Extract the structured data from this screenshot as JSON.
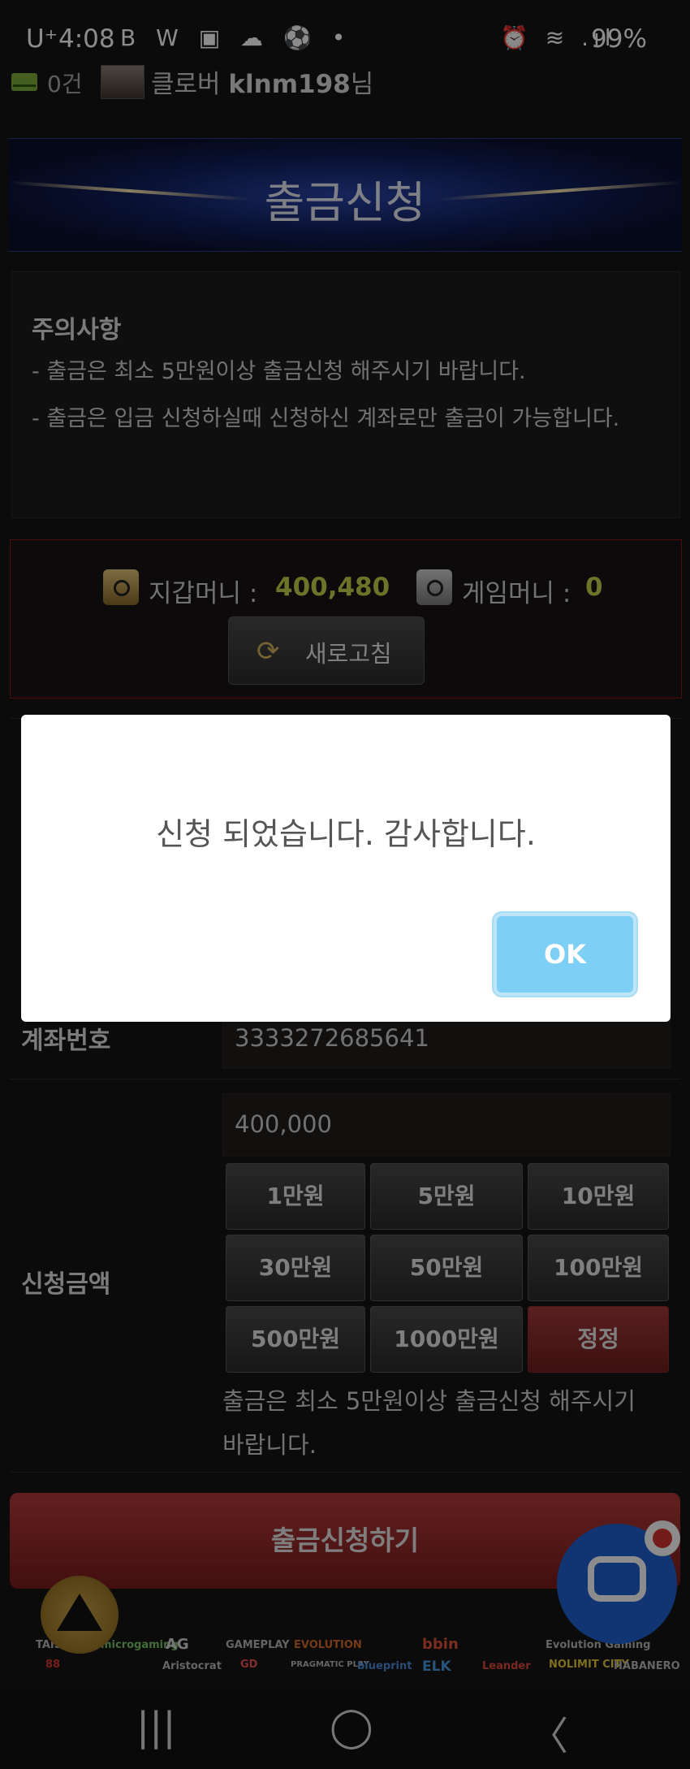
{
  "status_bar": {
    "time": "4:08",
    "carrier": "U⁺",
    "left_icons": "B W ▣ ☁ ⚽ •",
    "right_icons": "⏰ ≋ .ıl",
    "battery": "99%"
  },
  "user": {
    "mail_count": "0건",
    "prefix": "클로버",
    "name": "klnm198",
    "suffix": "님"
  },
  "page": {
    "title": "출금신청"
  },
  "notice": {
    "heading": "주의사항",
    "line1": "- 출금은 최소 5만원이상 출금신청 해주시기 바랍니다.",
    "line2": "- 출금은 입금 신청하실때 신청하신 계좌로만 출금이 가능합니다."
  },
  "wallet": {
    "wallet_label": "지갑머니 : ",
    "wallet_value": "400,480",
    "game_label": "게임머니 : ",
    "game_value": "0",
    "refresh_label": "새로고침"
  },
  "form": {
    "account_label": "계좌번호",
    "account_value": "3333272685641",
    "amount_label": "신청금액",
    "amount_value": "400,000",
    "amount_buttons": [
      "1만원",
      "5만원",
      "10만원",
      "30만원",
      "50만원",
      "100만원",
      "500만원",
      "1000만원",
      "정정"
    ],
    "note": "출금은 최소 5만원이상 출금신청 해주시기 바랍니다.",
    "submit_label": "출금신청하기"
  },
  "dialog": {
    "message": "신청 되었습니다. 감사합니다.",
    "ok_label": "OK"
  },
  "providers": [
    "TAISHAN",
    "microgaming",
    "AG",
    "GAMEPLAY",
    "EVOLUTION",
    "bbin",
    "Evolution Gaming",
    "88",
    "Aristocrat",
    "GD",
    "PRAGMATIC PLAY",
    "blueprint",
    "ELK",
    "Leander",
    "NOLIMIT CITY",
    "HABANERO"
  ],
  "colors": {
    "accent_red": "#8e1b1b",
    "money_green": "#c6d24a",
    "ok_blue": "#7ecff5"
  }
}
